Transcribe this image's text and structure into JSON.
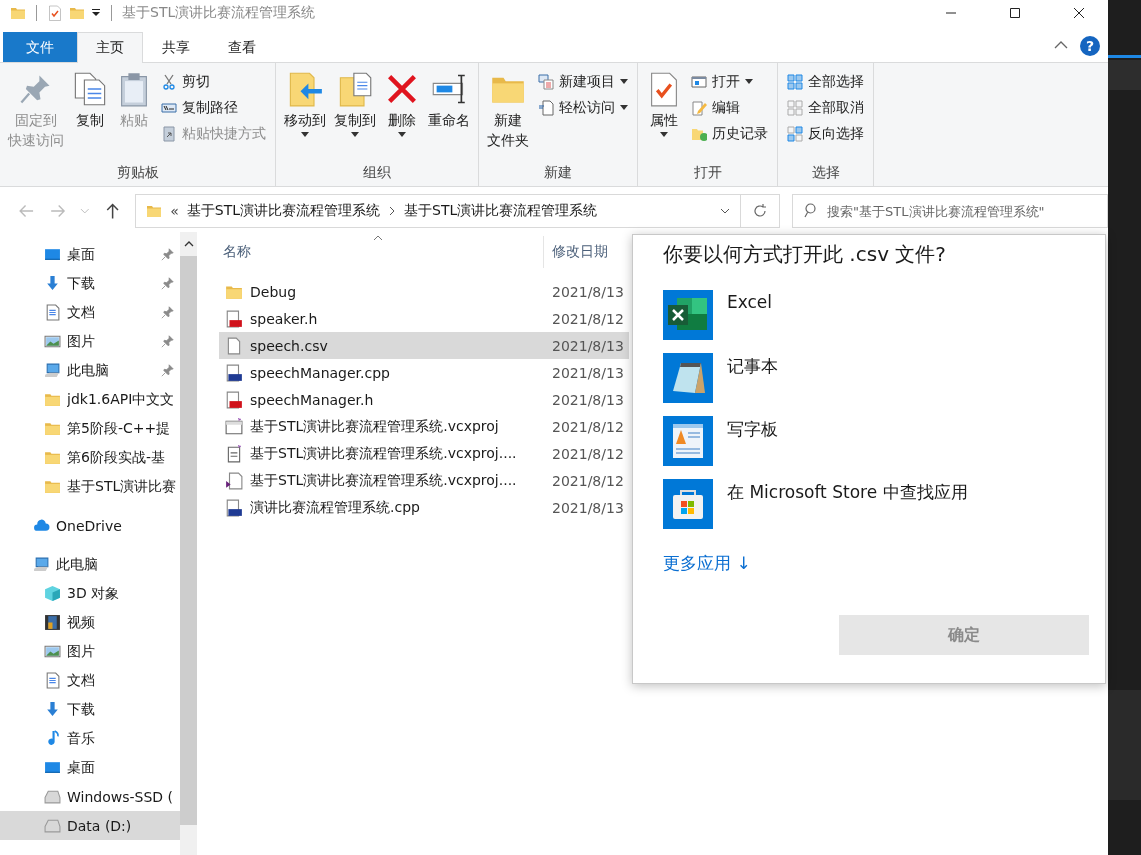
{
  "window": {
    "title": "基于STL演讲比赛流程管理系统",
    "help": "?"
  },
  "tabs": [
    {
      "label": "文件",
      "kind": "file",
      "selected": false
    },
    {
      "label": "主页",
      "kind": "tab",
      "selected": true
    },
    {
      "label": "共享",
      "kind": "tab",
      "selected": false
    },
    {
      "label": "查看",
      "kind": "tab",
      "selected": false
    }
  ],
  "ribbon": [
    {
      "label": "剪贴板",
      "items": [
        {
          "label": [
            "固定到",
            "快速访问"
          ],
          "kind": "large",
          "disabled": true,
          "dropdown": false
        },
        {
          "label": "复制",
          "kind": "large",
          "disabled": false,
          "dropdown": false
        },
        {
          "label": "粘贴",
          "kind": "large",
          "disabled": true,
          "dropdown": false
        },
        {
          "label": "剪切",
          "kind": "small",
          "disabled": false,
          "dropdown": false
        },
        {
          "label": "复制路径",
          "kind": "small",
          "disabled": false,
          "dropdown": false
        },
        {
          "label": "粘贴快捷方式",
          "kind": "small",
          "disabled": true,
          "dropdown": false
        }
      ]
    },
    {
      "label": "组织",
      "items": [
        {
          "label": "移动到",
          "kind": "large",
          "disabled": false,
          "dropdown": true
        },
        {
          "label": "复制到",
          "kind": "large",
          "disabled": false,
          "dropdown": true
        },
        {
          "label": "删除",
          "kind": "large",
          "disabled": false,
          "dropdown": true
        },
        {
          "label": "重命名",
          "kind": "large",
          "disabled": false,
          "dropdown": false
        }
      ]
    },
    {
      "label": "新建",
      "items": [
        {
          "label": [
            "新建",
            "文件夹"
          ],
          "kind": "large",
          "disabled": false,
          "dropdown": false
        },
        {
          "label": "新建项目",
          "kind": "small",
          "disabled": false,
          "dropdown": true
        },
        {
          "label": "轻松访问",
          "kind": "small",
          "disabled": false,
          "dropdown": true
        }
      ]
    },
    {
      "label": "打开",
      "items": [
        {
          "label": "属性",
          "kind": "large",
          "disabled": false,
          "dropdown": true
        },
        {
          "label": "打开",
          "kind": "small",
          "disabled": false,
          "dropdown": true
        },
        {
          "label": "编辑",
          "kind": "small",
          "disabled": false,
          "dropdown": false
        },
        {
          "label": "历史记录",
          "kind": "small",
          "disabled": false,
          "dropdown": false
        }
      ]
    },
    {
      "label": "选择",
      "items": [
        {
          "label": "全部选择",
          "kind": "small",
          "disabled": false,
          "dropdown": false
        },
        {
          "label": "全部取消",
          "kind": "small",
          "disabled": false,
          "dropdown": false
        },
        {
          "label": "反向选择",
          "kind": "small",
          "disabled": false,
          "dropdown": false
        }
      ]
    }
  ],
  "address": {
    "overflow": "«",
    "crumbs": [
      "基于STL演讲比赛流程管理系统",
      "基于STL演讲比赛流程管理系统"
    ]
  },
  "search": {
    "placeholder": "搜索\"基于STL演讲比赛流程管理系统\""
  },
  "sidebar": {
    "quick_access": [
      {
        "label": "桌面",
        "pinned": true,
        "selected": false
      },
      {
        "label": "下载",
        "pinned": true,
        "selected": false
      },
      {
        "label": "文档",
        "pinned": true,
        "selected": false
      },
      {
        "label": "图片",
        "pinned": true,
        "selected": false
      },
      {
        "label": "此电脑",
        "pinned": true,
        "selected": false
      },
      {
        "label": "jdk1.6API中文文",
        "pinned": false,
        "selected": false
      },
      {
        "label": "第5阶段-C++提",
        "pinned": false,
        "selected": false
      },
      {
        "label": "第6阶段实战-基",
        "pinned": false,
        "selected": false
      },
      {
        "label": "基于STL演讲比赛",
        "pinned": false,
        "selected": false
      }
    ],
    "tree": [
      {
        "label": "OneDrive",
        "selected": false
      },
      {
        "label": "此电脑",
        "selected": false,
        "children": [
          {
            "label": "3D 对象",
            "selected": false
          },
          {
            "label": "视频",
            "selected": false
          },
          {
            "label": "图片",
            "selected": false
          },
          {
            "label": "文档",
            "selected": false
          },
          {
            "label": "下载",
            "selected": false
          },
          {
            "label": "音乐",
            "selected": false
          },
          {
            "label": "桌面",
            "selected": false
          },
          {
            "label": "Windows-SSD (",
            "selected": false
          },
          {
            "label": "Data (D:)",
            "selected": true
          }
        ]
      }
    ]
  },
  "files": {
    "columns": [
      "名称",
      "修改日期"
    ],
    "rows": [
      {
        "name": "Debug",
        "kind": "folder",
        "date": "2021/8/13",
        "selected": false
      },
      {
        "name": "speaker.h",
        "kind": "header",
        "date": "2021/8/12",
        "selected": false
      },
      {
        "name": "speech.csv",
        "kind": "blank",
        "date": "2021/8/13",
        "selected": true
      },
      {
        "name": "speechManager.cpp",
        "kind": "cpp",
        "date": "2021/8/13",
        "selected": false
      },
      {
        "name": "speechManager.h",
        "kind": "header",
        "date": "2021/8/13",
        "selected": false
      },
      {
        "name": "基于STL演讲比赛流程管理系统.vcxproj",
        "kind": "project",
        "date": "2021/8/12",
        "selected": false
      },
      {
        "name": "基于STL演讲比赛流程管理系统.vcxproj....",
        "kind": "filters",
        "date": "2021/8/12",
        "selected": false
      },
      {
        "name": "基于STL演讲比赛流程管理系统.vcxproj....",
        "kind": "user",
        "date": "2021/8/12",
        "selected": false
      },
      {
        "name": "演讲比赛流程管理系统.cpp",
        "kind": "cpp",
        "date": "2021/8/13",
        "selected": false
      }
    ]
  },
  "dialog": {
    "title": "你要以何方式打开此 .csv 文件?",
    "apps": [
      {
        "name": "Excel",
        "kind": "excel"
      },
      {
        "name": "记事本",
        "kind": "notepad"
      },
      {
        "name": "写字板",
        "kind": "wordpad"
      },
      {
        "name": "在 Microsoft Store 中查找应用",
        "kind": "store"
      }
    ],
    "more_link": "更多应用 ↓",
    "confirm": {
      "label": "确定",
      "disabled": true
    }
  }
}
